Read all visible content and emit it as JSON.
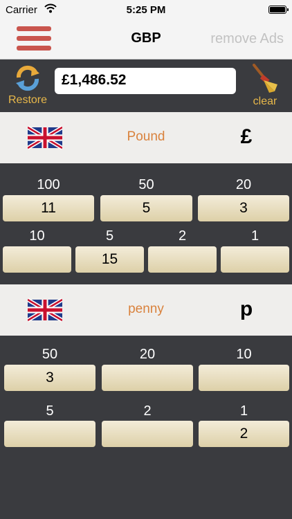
{
  "status_bar": {
    "carrier": "Carrier",
    "time": "5:25 PM"
  },
  "nav": {
    "title": "GBP",
    "remove_ads": "remove Ads"
  },
  "toolbar": {
    "restore_label": "Restore",
    "amount": "£1,486.52",
    "clear_label": "clear"
  },
  "colors": {
    "accent_orange": "#e8b84a",
    "menu_red": "#c9554d",
    "unit_name": "#d9823d",
    "background": "#3a3b3f"
  },
  "sections": [
    {
      "name": "Pound",
      "symbol": "£",
      "rows": [
        [
          {
            "label": "100",
            "count": "11"
          },
          {
            "label": "50",
            "count": "5"
          },
          {
            "label": "20",
            "count": "3"
          }
        ],
        [
          {
            "label": "10",
            "count": ""
          },
          {
            "label": "5",
            "count": "15"
          },
          {
            "label": "2",
            "count": ""
          },
          {
            "label": "1",
            "count": ""
          }
        ]
      ]
    },
    {
      "name": "penny",
      "symbol": "p",
      "rows": [
        [
          {
            "label": "50",
            "count": "3"
          },
          {
            "label": "20",
            "count": ""
          },
          {
            "label": "10",
            "count": ""
          }
        ],
        [
          {
            "label": "5",
            "count": ""
          },
          {
            "label": "2",
            "count": ""
          },
          {
            "label": "1",
            "count": "2"
          }
        ]
      ]
    }
  ]
}
